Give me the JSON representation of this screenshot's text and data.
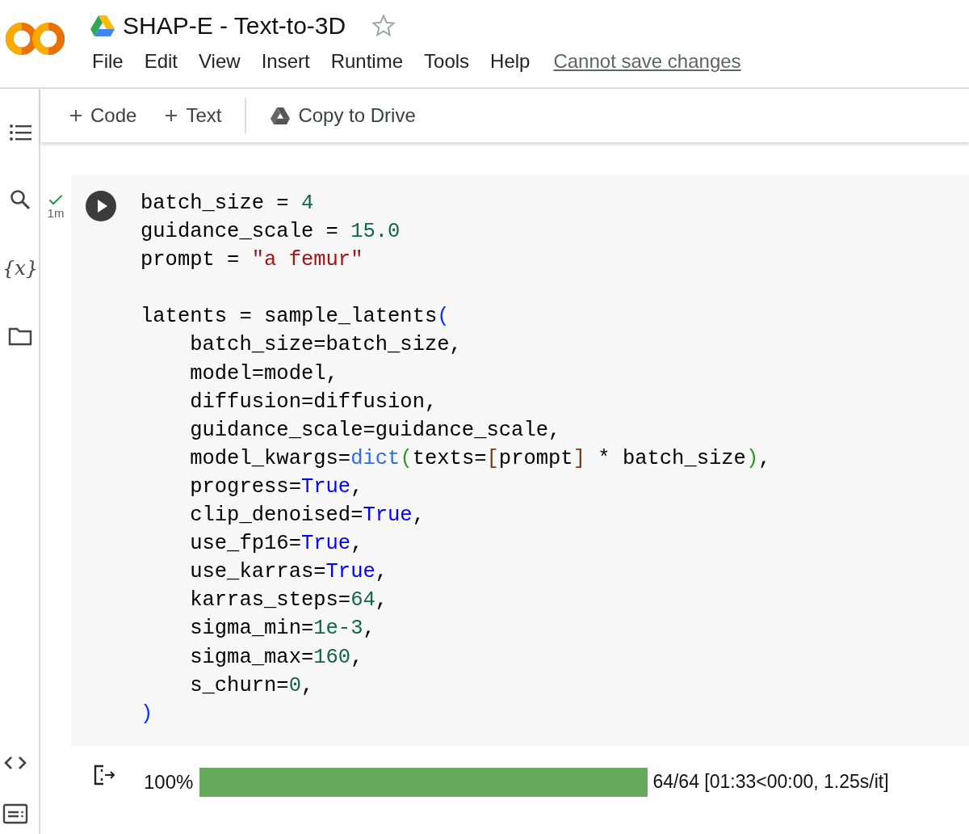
{
  "header": {
    "title": "SHAP-E - Text-to-3D",
    "starred": false,
    "menu": [
      "File",
      "Edit",
      "View",
      "Insert",
      "Runtime",
      "Tools",
      "Help"
    ],
    "save_status": "Cannot save changes"
  },
  "sidebar": {
    "variables_label": "{x}"
  },
  "toolbar": [
    {
      "kind": "add",
      "label": "Code"
    },
    {
      "kind": "add",
      "label": "Text"
    },
    {
      "kind": "drive",
      "label": "Copy to Drive"
    }
  ],
  "cell": {
    "succeeded": true,
    "time": "1m",
    "lines": [
      [
        {
          "kind": "plain",
          "text": "batch_size = "
        },
        {
          "kind": "number",
          "text": "4"
        }
      ],
      [
        {
          "kind": "plain",
          "text": "guidance_scale = "
        },
        {
          "kind": "number",
          "text": "15.0"
        }
      ],
      [
        {
          "kind": "plain",
          "text": "prompt = "
        },
        {
          "kind": "string",
          "text": "\"a femur\""
        }
      ],
      [
        {
          "kind": "blank"
        }
      ],
      [
        {
          "kind": "plain",
          "text": "latents = sample_latents"
        },
        {
          "kind": "bracket1",
          "text": "("
        }
      ],
      [
        {
          "kind": "plain",
          "text": "    batch_size=batch_size,"
        }
      ],
      [
        {
          "kind": "plain",
          "text": "    model=model,"
        }
      ],
      [
        {
          "kind": "plain",
          "text": "    diffusion=diffusion,"
        }
      ],
      [
        {
          "kind": "plain",
          "text": "    guidance_scale=guidance_scale,"
        }
      ],
      [
        {
          "kind": "plain",
          "text": "    model_kwargs="
        },
        {
          "kind": "builtin",
          "text": "dict"
        },
        {
          "kind": "bracket2",
          "text": "("
        },
        {
          "kind": "plain",
          "text": "texts="
        },
        {
          "kind": "bracket3",
          "text": "["
        },
        {
          "kind": "plain",
          "text": "prompt"
        },
        {
          "kind": "bracket3",
          "text": "]"
        },
        {
          "kind": "plain",
          "text": " * batch_size"
        },
        {
          "kind": "bracket2",
          "text": ")"
        },
        {
          "kind": "plain",
          "text": ","
        }
      ],
      [
        {
          "kind": "plain",
          "text": "    progress="
        },
        {
          "kind": "keyword",
          "text": "True"
        },
        {
          "kind": "plain",
          "text": ","
        }
      ],
      [
        {
          "kind": "plain",
          "text": "    clip_denoised="
        },
        {
          "kind": "keyword",
          "text": "True"
        },
        {
          "kind": "plain",
          "text": ","
        }
      ],
      [
        {
          "kind": "plain",
          "text": "    use_fp16="
        },
        {
          "kind": "keyword",
          "text": "True"
        },
        {
          "kind": "plain",
          "text": ","
        }
      ],
      [
        {
          "kind": "plain",
          "text": "    use_karras="
        },
        {
          "kind": "keyword",
          "text": "True"
        },
        {
          "kind": "plain",
          "text": ","
        }
      ],
      [
        {
          "kind": "plain",
          "text": "    karras_steps="
        },
        {
          "kind": "number",
          "text": "64"
        },
        {
          "kind": "plain",
          "text": ","
        }
      ],
      [
        {
          "kind": "plain",
          "text": "    sigma_min="
        },
        {
          "kind": "number",
          "text": "1e-3"
        },
        {
          "kind": "plain",
          "text": ","
        }
      ],
      [
        {
          "kind": "plain",
          "text": "    sigma_max="
        },
        {
          "kind": "number",
          "text": "160"
        },
        {
          "kind": "plain",
          "text": ","
        }
      ],
      [
        {
          "kind": "plain",
          "text": "    s_churn="
        },
        {
          "kind": "number",
          "text": "0"
        },
        {
          "kind": "plain",
          "text": ","
        }
      ],
      [
        {
          "kind": "bracket1",
          "text": ")"
        }
      ]
    ]
  },
  "output": {
    "percent": "100%",
    "level": 1.0,
    "stats": "64/64 [01:33<00:00, 1.25s/it]"
  }
}
